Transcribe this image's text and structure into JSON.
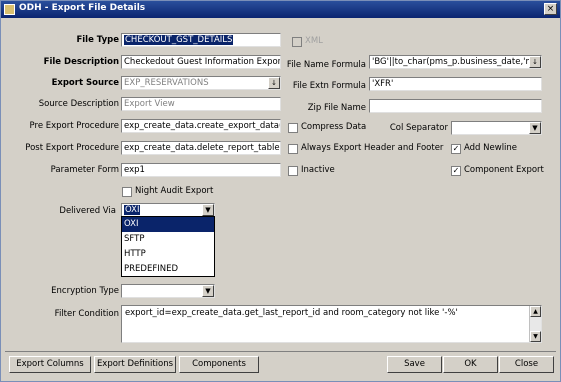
{
  "window": {
    "title": "ODH - Export File Details",
    "close_glyph": "×"
  },
  "left": {
    "file_type": {
      "label": "File Type",
      "value": "CHECKOUT_GST_DETAILS"
    },
    "file_description": {
      "label": "File Description",
      "value": "Checkedout Guest Information Export"
    },
    "export_source": {
      "label": "Export Source",
      "value": "EXP_RESERVATIONS"
    },
    "source_description": {
      "label": "Source Description",
      "value": "Export View"
    },
    "pre_export": {
      "label": "Pre Export Procedure",
      "value": "exp_create_data.create_export_data(pi"
    },
    "post_export": {
      "label": "Post Export Procedure",
      "value": "exp_create_data.delete_report_table"
    },
    "parameter_form": {
      "label": "Parameter Form",
      "value": "exp1"
    },
    "night_audit": {
      "label": "Night Audit Export"
    },
    "delivered_via": {
      "label": "Delivered Via",
      "value": "OXI",
      "options": [
        "OXI",
        "SFTP",
        "HTTP",
        "PREDEFINED"
      ]
    },
    "encryption_type": {
      "label": "Encryption Type",
      "value": ""
    },
    "filter_condition": {
      "label": "Filter Condition",
      "value": "export_id=exp_create_data.get_last_report_id and room_category not like '-%'"
    }
  },
  "right": {
    "xml": {
      "label": "XML"
    },
    "file_name_formula": {
      "label": "File Name Formula",
      "value": "'BG'||to_char(pms_p.business_date,'m"
    },
    "file_extn_formula": {
      "label": "File Extn Formula",
      "value": "'XFR'"
    },
    "zip_file_name": {
      "label": "Zip File Name",
      "value": ""
    },
    "compress_data": {
      "label": "Compress Data"
    },
    "col_separator": {
      "label": "Col Separator",
      "value": ""
    },
    "always_export_header": {
      "label": "Always Export Header and Footer"
    },
    "add_newline": {
      "label": "Add Newline",
      "checked": "✓"
    },
    "inactive": {
      "label": "Inactive"
    },
    "component_export": {
      "label": "Component Export",
      "checked": "✓"
    }
  },
  "buttons": {
    "export_columns": "Export Columns",
    "export_definitions": "Export Definitions",
    "components": "Components",
    "save": "Save",
    "ok": "OK",
    "close": "Close"
  }
}
